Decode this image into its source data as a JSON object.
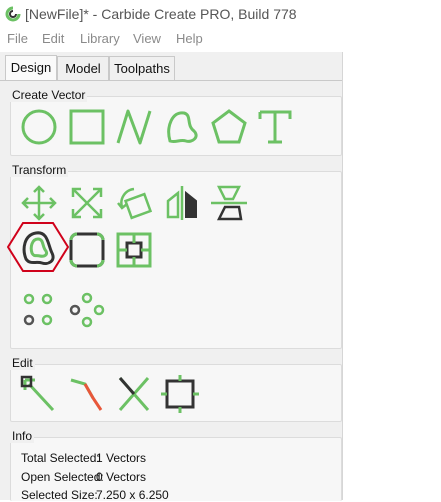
{
  "window": {
    "title": "[NewFile]* - Carbide Create PRO, Build 778"
  },
  "menu": [
    "File",
    "Edit",
    "Library",
    "View",
    "Help"
  ],
  "tabs": [
    "Design",
    "Model",
    "Toolpaths"
  ],
  "sections": {
    "create_vector": "Create Vector",
    "transform": "Transform",
    "edit": "Edit",
    "info": "Info"
  },
  "info": {
    "total_selected_label": "Total Selected:",
    "total_selected_value": "1 Vectors",
    "open_selected_label": "Open Selected:",
    "open_selected_value": "0 Vectors",
    "selected_size_label": "Selected Size:",
    "selected_size_value": "7.250 x 6.250"
  },
  "colors": {
    "accent": "#6cc164",
    "dark": "#333333",
    "highlight": "#d0021b",
    "edit_red": "#e8573a"
  }
}
